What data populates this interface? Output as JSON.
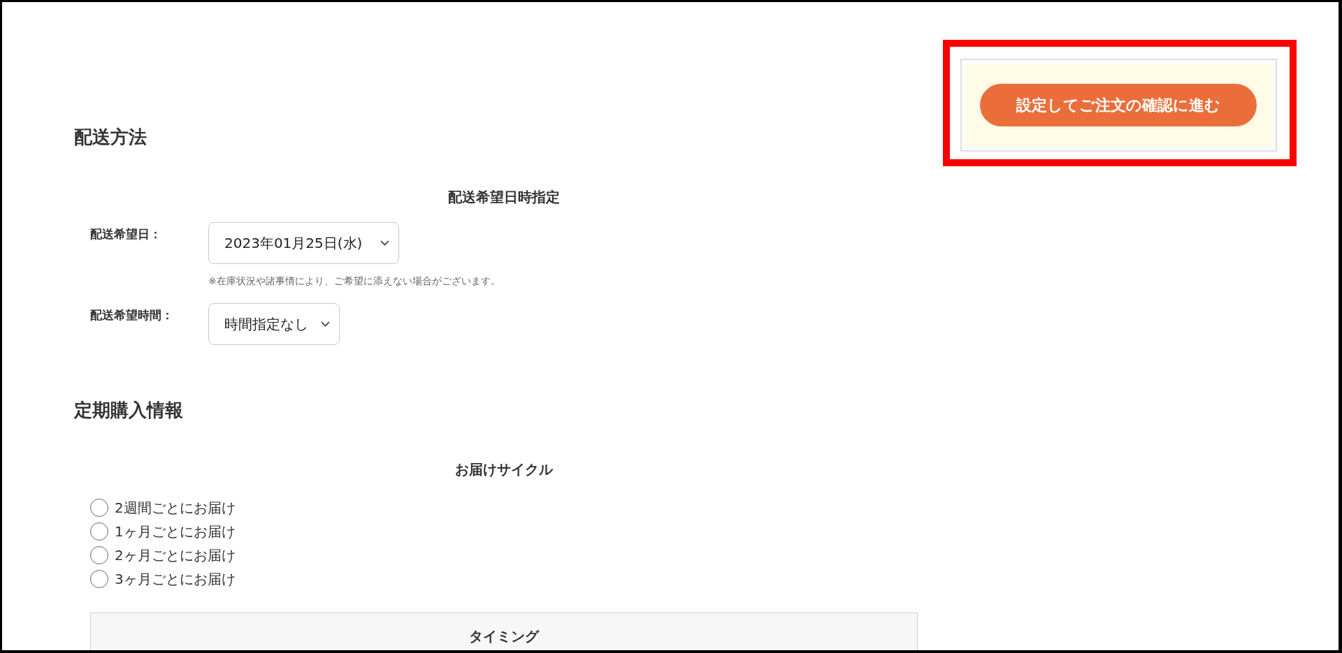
{
  "delivery": {
    "title": "配送方法",
    "subtitle": "配送希望日時指定",
    "fields": [
      {
        "kind": "select",
        "label": "配送希望日：",
        "value": "2023年01月25日(水)",
        "note": "※在庫状況や諸事情により、ご希望に添えない場合がございます。"
      },
      {
        "kind": "select",
        "label": "配送希望時間：",
        "value": "時間指定なし"
      }
    ]
  },
  "subscription": {
    "title": "定期購入情報",
    "subtitle": "お届けサイクル",
    "options": [
      {
        "label": "2週間ごとにお届け",
        "selected": false
      },
      {
        "label": "1ヶ月ごとにお届け",
        "selected": false
      },
      {
        "label": "2ヶ月ごとにお届け",
        "selected": false
      },
      {
        "label": "3ヶ月ごとにお届け",
        "selected": false
      }
    ],
    "timing": {
      "title": "タイミング"
    }
  },
  "sidebar": {
    "button": "設定してご注文の確認に進む"
  }
}
